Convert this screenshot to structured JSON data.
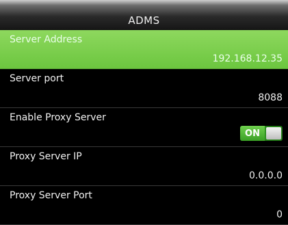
{
  "window": {
    "title": "ADMS"
  },
  "settings": [
    {
      "label": "Server Address",
      "value": "192.168.12.35"
    },
    {
      "label": "Server port",
      "value": "8088"
    },
    {
      "label": "Enable Proxy Server",
      "toggle": "ON"
    },
    {
      "label": "Proxy Server IP",
      "value": "0.0.0.0"
    },
    {
      "label": "Proxy Server Port",
      "value": "0"
    }
  ],
  "colors": {
    "selected_row": "#7ccf4e",
    "toggle_on": "#3a9f25"
  }
}
